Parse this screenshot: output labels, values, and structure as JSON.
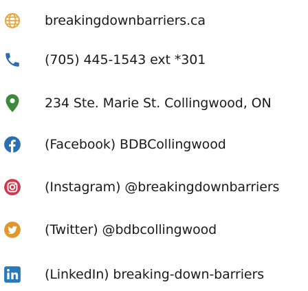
{
  "colors": {
    "globe": "#e8a43a",
    "phone": "#2a6db3",
    "location": "#3c8a3c",
    "facebook": "#2b6fb3",
    "instagram": "#d2344a",
    "twitter": "#e2962c",
    "linkedin": "#2a79b8"
  },
  "contacts": [
    {
      "icon": "globe-icon",
      "text": "breakingdownbarriers.ca"
    },
    {
      "icon": "phone-icon",
      "text": "(705) 445-1543 ext *301"
    },
    {
      "icon": "location-pin-icon",
      "text": "234 Ste. Marie St. Collingwood, ON"
    },
    {
      "icon": "facebook-icon",
      "text": "(Facebook) BDBCollingwood"
    },
    {
      "icon": "instagram-icon",
      "text": "(Instagram) @breakingdownbarriers"
    },
    {
      "icon": "twitter-icon",
      "text": "(Twitter) @bdbcollingwood"
    },
    {
      "icon": "linkedin-icon",
      "text": "(LinkedIn) breaking-down-barriers"
    }
  ]
}
